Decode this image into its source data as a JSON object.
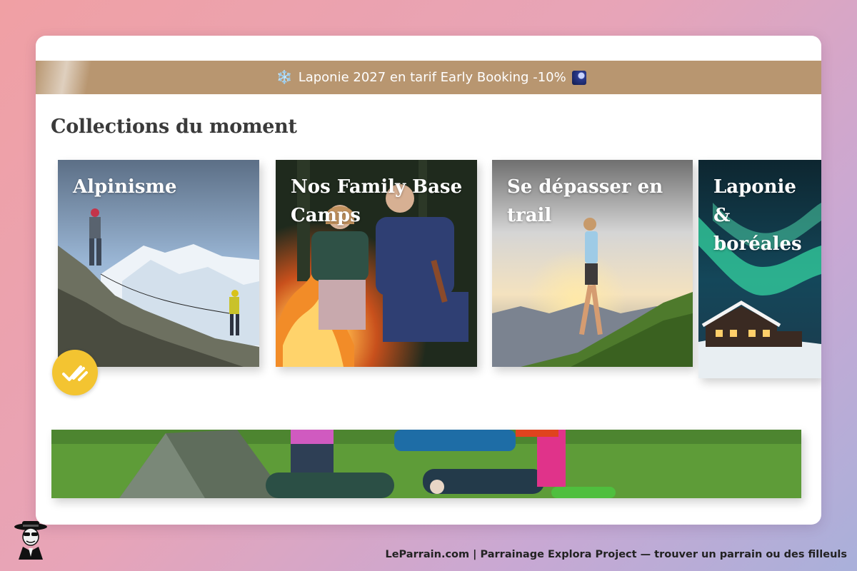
{
  "promo": {
    "text": "Laponie 2027 en tarif Early Booking -10%",
    "leading_icon": "snowflake-icon",
    "trailing_icon": "night-sky-icon"
  },
  "section": {
    "title": "Collections du moment"
  },
  "collections": [
    {
      "label": "Alpinisme",
      "image": "mountaineers-on-rocky-ridge"
    },
    {
      "label": "Nos Family Base Camps",
      "image": "father-and-son-at-campfire"
    },
    {
      "label": "Se dépasser en trail",
      "image": "trail-runner-on-mountain-at-sunset"
    },
    {
      "label": "Laponie & boréales",
      "image": "cabin-under-northern-lights"
    }
  ],
  "badge": {
    "icon": "check-marks-icon"
  },
  "banner": {
    "image": "children-lying-on-grass-near-tent"
  },
  "footer": {
    "text": "LeParrain.com | Parrainage Explora Project — trouver un parrain ou des filleuls",
    "logo": "parrain-mascot-logo"
  },
  "colors": {
    "promo_bar": "#b89670",
    "badge": "#f3c431",
    "title": "#3a3a3a"
  }
}
